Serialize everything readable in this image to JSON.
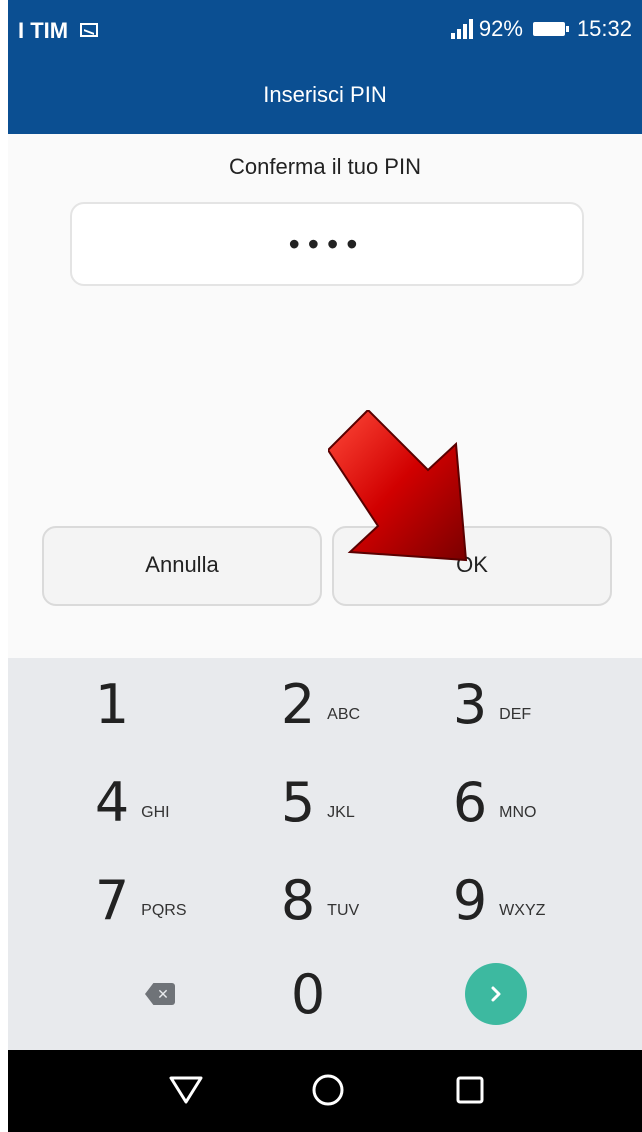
{
  "status_bar": {
    "carrier": "I TIM",
    "battery": "92%",
    "time": "15:32"
  },
  "header": {
    "title": "Inserisci PIN"
  },
  "prompt": "Conferma il tuo PIN",
  "pin_field": {
    "value": "••••"
  },
  "buttons": {
    "cancel": "Annulla",
    "ok": "OK"
  },
  "keypad": {
    "keys": [
      {
        "num": "1",
        "letters": ""
      },
      {
        "num": "2",
        "letters": "ABC"
      },
      {
        "num": "3",
        "letters": "DEF"
      },
      {
        "num": "4",
        "letters": "GHI"
      },
      {
        "num": "5",
        "letters": "JKL"
      },
      {
        "num": "6",
        "letters": "MNO"
      },
      {
        "num": "7",
        "letters": "PQRS"
      },
      {
        "num": "8",
        "letters": "TUV"
      },
      {
        "num": "9",
        "letters": "WXYZ"
      },
      {
        "num": "0",
        "letters": ""
      }
    ],
    "accent_color": "#3db9a0"
  },
  "colors": {
    "header": "#0b4f92",
    "arrow": "#d10000"
  },
  "icons": [
    "sms-icon",
    "signal-icon",
    "battery-icon",
    "backspace-icon",
    "next-chevron-icon",
    "back-icon",
    "home-icon",
    "recents-icon",
    "red-arrow-icon"
  ]
}
